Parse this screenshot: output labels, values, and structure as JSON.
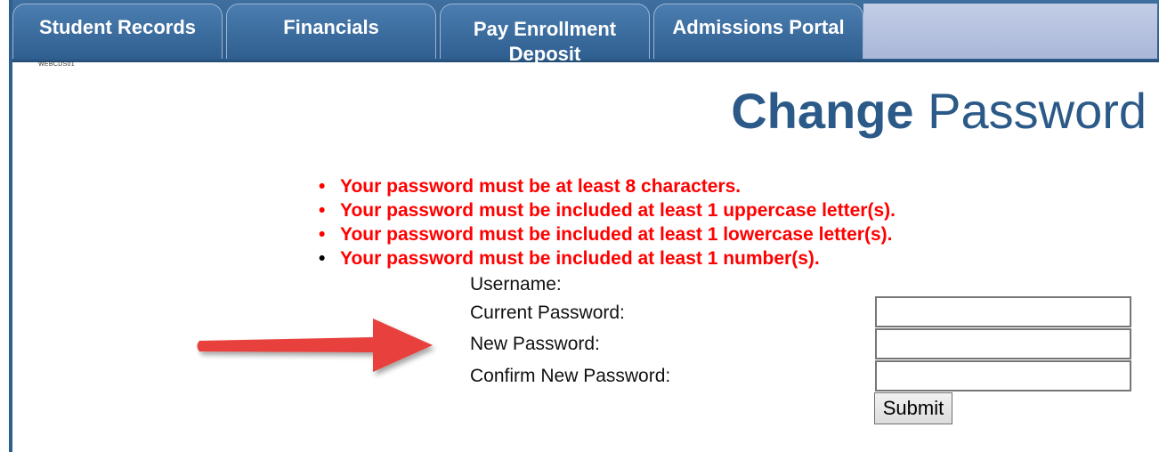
{
  "tabs": [
    {
      "label": "Student Records"
    },
    {
      "label": "Financials"
    },
    {
      "label": "Pay Enrollment Deposit"
    },
    {
      "label": "Admissions Portal"
    }
  ],
  "server_id": "WEBCDS01",
  "title": {
    "bold": "Change",
    "regular": "Password"
  },
  "rules": [
    "Your password must be at least 8 characters.",
    "Your password must be included at least 1 uppercase letter(s).",
    "Your password must be included at least 1 lowercase letter(s).",
    "Your password must be included at least 1 number(s)."
  ],
  "form": {
    "username_label": "Username:",
    "username_value": "",
    "current_password_label": "Current Password:",
    "new_password_label": "New Password:",
    "confirm_password_label": "Confirm New Password:",
    "submit_label": "Submit"
  },
  "colors": {
    "brand_blue": "#2c5a88",
    "error_red": "#ff0000",
    "arrow_red": "#e8413d"
  },
  "annotations": {
    "arrow_icon": "red-arrow-right"
  }
}
